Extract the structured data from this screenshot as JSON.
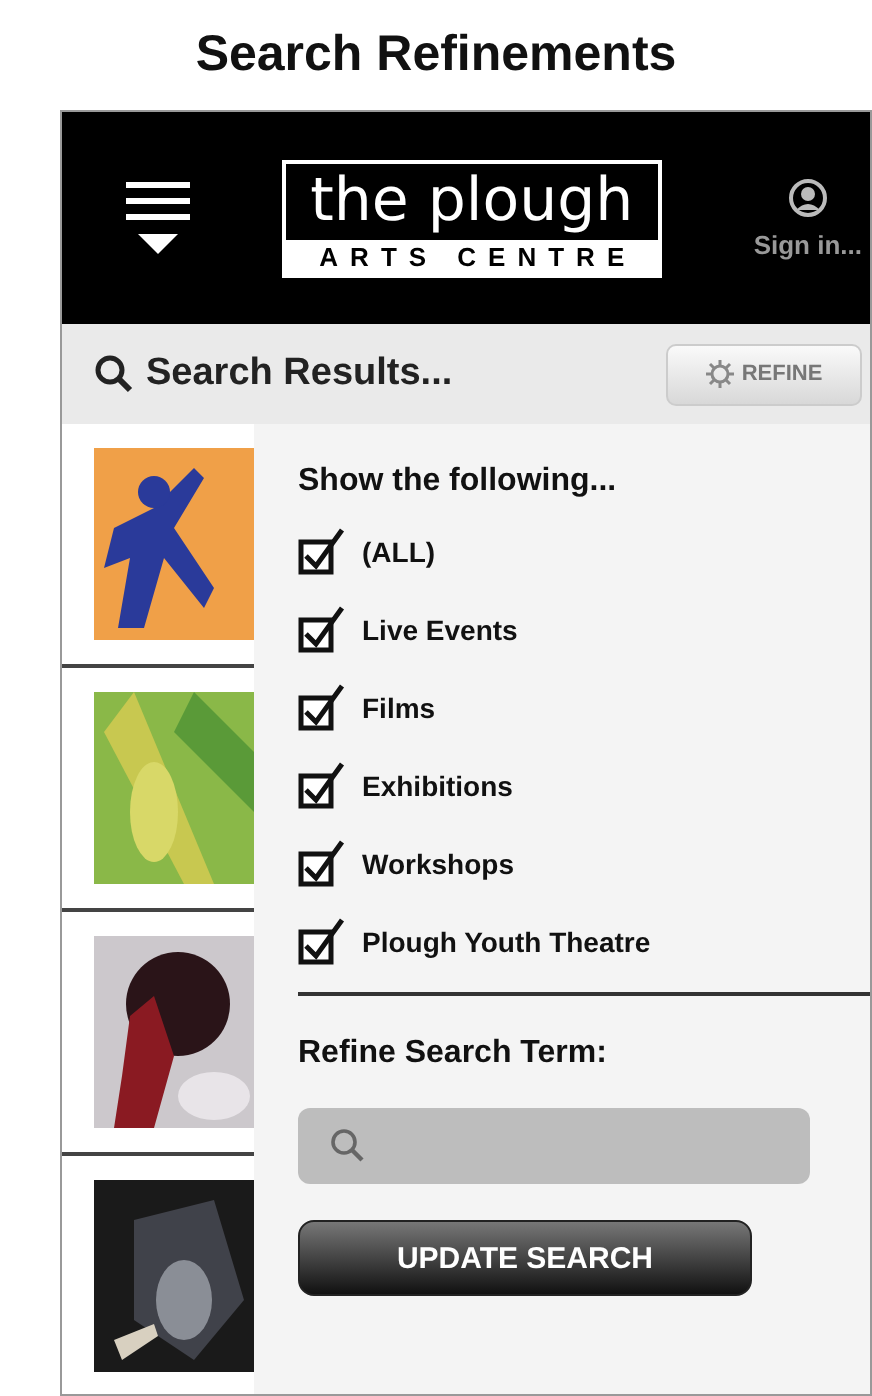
{
  "page_title": "Search Refinements",
  "header": {
    "logo_top": "the plough",
    "logo_bottom": "ARTS CENTRE",
    "sign_in": "Sign in..."
  },
  "search_bar": {
    "title": "Search Results...",
    "refine_button": "REFINE"
  },
  "refine_panel": {
    "heading": "Show the following...",
    "filters": [
      {
        "label": "(ALL)",
        "checked": true
      },
      {
        "label": "Live Events",
        "checked": true
      },
      {
        "label": "Films",
        "checked": true
      },
      {
        "label": "Exhibitions",
        "checked": true
      },
      {
        "label": "Workshops",
        "checked": true
      },
      {
        "label": "Plough Youth Theatre",
        "checked": true
      }
    ],
    "term_label": "Refine Search Term:",
    "update_button": "UPDATE SEARCH"
  }
}
